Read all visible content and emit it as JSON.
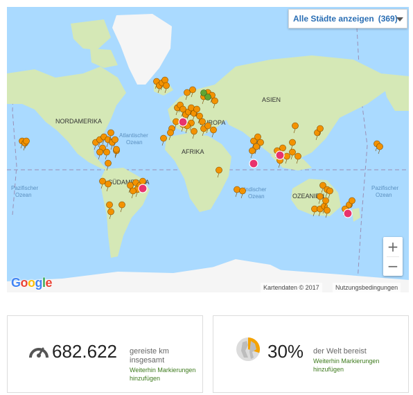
{
  "map": {
    "dropdown_label": "Alle Städte anzeigen",
    "dropdown_count": "(369)",
    "zoom_in": "+",
    "zoom_out": "−",
    "google_logo": "Google",
    "map_data": "Kartendaten © 2017",
    "terms": "Nutzungsbedingungen",
    "labels": {
      "north_america": "NORDAMERIKA",
      "south_america": "SÜDAMERIKA",
      "europe": "EUROPA",
      "asia": "ASIEN",
      "africa": "AFRIKA",
      "oceania": "OZEANIEN",
      "atlantic_1": "Atlantischer",
      "atlantic_2": "Ozean",
      "pacific_1": "Pazifischer",
      "pacific_2": "Ozean",
      "pacific_r1": "Pazifischer",
      "pacific_r2": "Ozean",
      "indian_1": "Indischer",
      "indian_2": "Ozean"
    },
    "colors": {
      "water": "#aadaff",
      "land": "#d5e8b6",
      "ice": "#f5f5f5",
      "pin_orange": "#f39200",
      "pin_pink": "#e8336e",
      "pin_green": "#5fa533"
    }
  },
  "stats": {
    "km": {
      "icon": "speedometer-icon",
      "value": "682.622",
      "label_line1": "gereiste km",
      "label_line2": "insgesamt",
      "link_line1": "Weiterhin Markierungen",
      "link_line2": "hinzufügen"
    },
    "world": {
      "icon": "world-pie-icon",
      "value": "30%",
      "percent": 30,
      "label": "der Welt bereist",
      "link_line1": "Weiterhin Markierungen",
      "link_line2": "hinzufügen"
    }
  }
}
